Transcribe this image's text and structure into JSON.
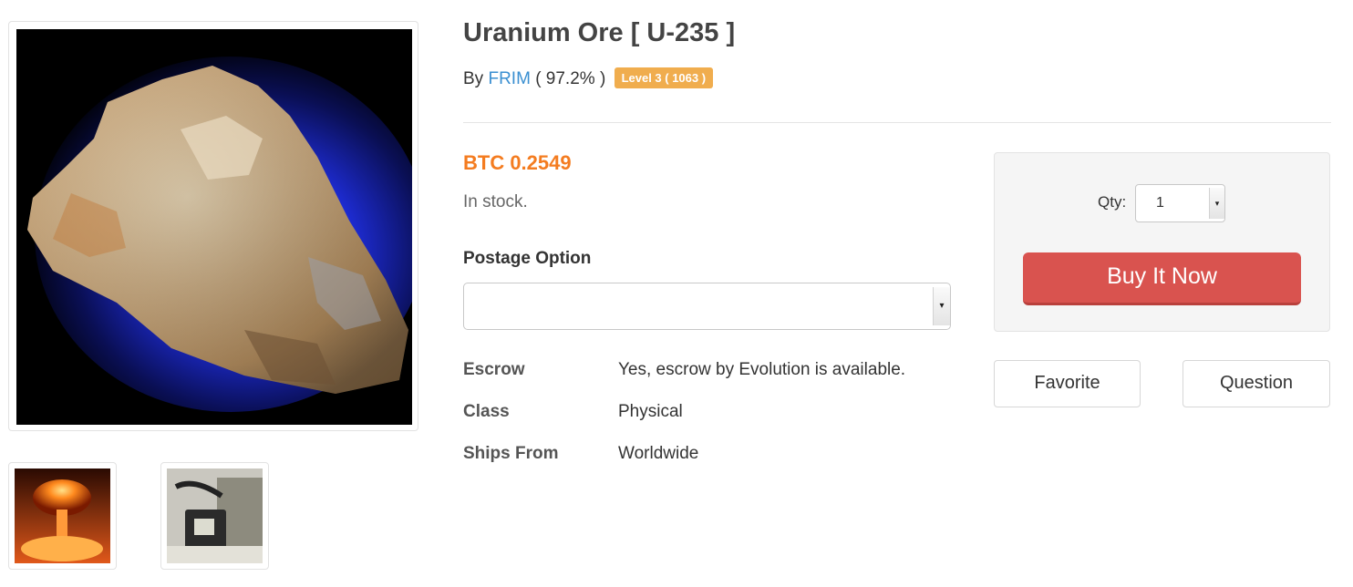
{
  "product": {
    "title": "Uranium Ore [ U-235 ]",
    "by_prefix": "By",
    "seller": "FRIM",
    "rating": "( 97.2% )",
    "level_badge": "Level 3 ( 1063 )",
    "price": "BTC 0.2549",
    "stock": "In stock.",
    "postage_label": "Postage Option",
    "postage_value": ""
  },
  "details": [
    {
      "label": "Escrow",
      "value": "Yes, escrow by Evolution is available."
    },
    {
      "label": "Class",
      "value": "Physical"
    },
    {
      "label": "Ships From",
      "value": "Worldwide"
    }
  ],
  "purchase": {
    "qty_label": "Qty:",
    "qty_value": "1",
    "buy_label": "Buy It Now"
  },
  "actions": {
    "favorite_label": "Favorite",
    "question_label": "Question"
  },
  "colors": {
    "price": "#f47c20",
    "badge": "#f0ad4e",
    "buy_button": "#d9534f",
    "seller_link": "#3a8fd1"
  },
  "images": {
    "main": "uranium-ore-rock-photo",
    "thumbs": [
      "mushroom-cloud-photo",
      "geiger-counter-photo"
    ]
  }
}
